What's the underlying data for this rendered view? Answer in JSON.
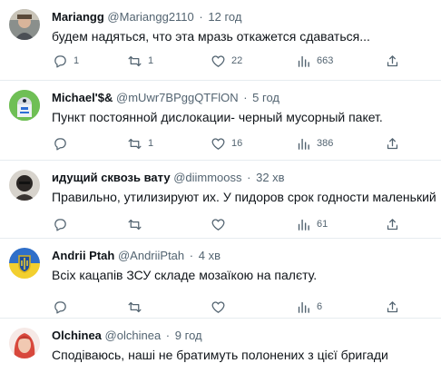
{
  "tweets": [
    {
      "name": "Mariangg",
      "handle": "@Mariangg2110",
      "time": "12 год",
      "text": "будем надяться, что эта мразь откажется сдаваться...",
      "reply_count": "1",
      "retweet_count": "1",
      "like_count": "22",
      "view_count": "663",
      "avatar": "profile-photo-avatar"
    },
    {
      "name": "Michael'$&",
      "handle": "@mUwr7BPggQTFlON",
      "time": "5 год",
      "text": "Пункт постоянной дислокации- черный мусорный пакет.",
      "reply_count": "",
      "retweet_count": "1",
      "like_count": "16",
      "view_count": "386",
      "avatar": "robot-avatar"
    },
    {
      "name": "идущий сквозь вату",
      "handle": "@diimmooss",
      "time": "32 хв",
      "text": "Правильно, утилизируют их. У пидоров срок годности маленький",
      "reply_count": "",
      "retweet_count": "",
      "like_count": "",
      "view_count": "61",
      "avatar": "dark-photo-avatar"
    },
    {
      "name": "Andrii Ptah",
      "handle": "@AndriiPtah",
      "time": "4 хв",
      "text": "Всіх кацапів ЗСУ складе мозаїкою на палєту.",
      "reply_count": "",
      "retweet_count": "",
      "like_count": "",
      "view_count": "6",
      "avatar": "coat-of-arms-avatar"
    },
    {
      "name": "Olchinea",
      "handle": "@olchinea",
      "time": "9 год",
      "text": "Сподіваюсь, наші не братимуть полонених з цієї бригади",
      "avatar": "red-hair-avatar"
    }
  ],
  "separator": "·",
  "icons": {
    "reply": "reply-icon",
    "retweet": "retweet-icon",
    "like": "heart-icon",
    "views": "views-icon",
    "share": "share-icon"
  },
  "colors": {
    "text": "#0f1419",
    "secondary": "#536471",
    "divider": "#e6ecf0"
  }
}
